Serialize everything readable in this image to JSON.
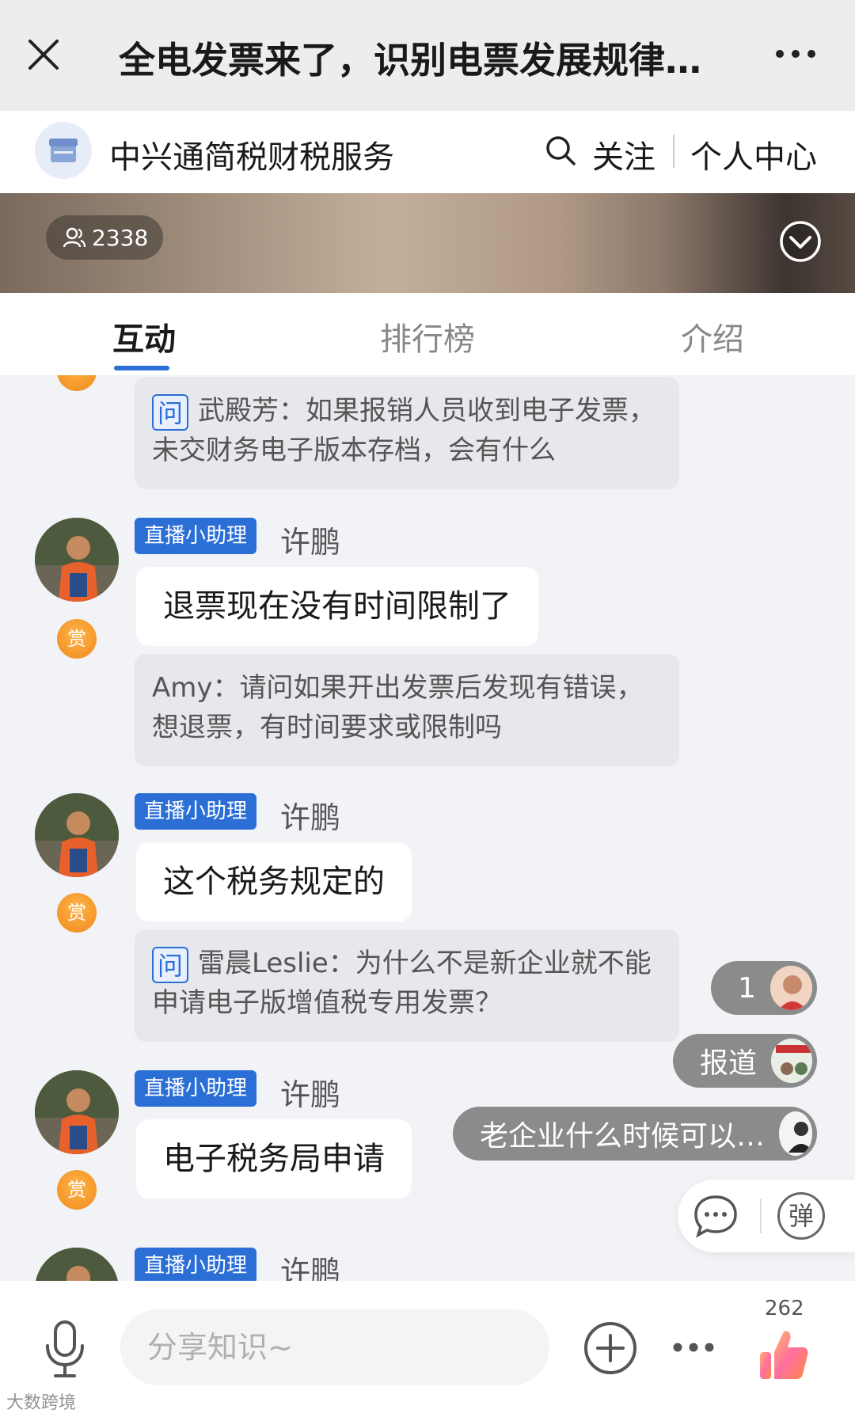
{
  "topbar": {
    "title": "全电发票来了，识别电票发展规律…"
  },
  "channel": {
    "name": "中兴通简税财税服务",
    "follow_label": "关注",
    "personal_label": "个人中心"
  },
  "video": {
    "viewer_count": "2338"
  },
  "tabs": [
    {
      "label": "互动",
      "active": true
    },
    {
      "label": "排行榜",
      "active": false
    },
    {
      "label": "介绍",
      "active": false
    }
  ],
  "feed": {
    "q_tag": "问",
    "role_tag": "直播小助理",
    "reward_label": "赏",
    "questions": [
      {
        "text": "武殿芳：如果报销人员收到电子发票，未交财务电子版本存档，会有什么"
      },
      {
        "text": "Amy：请问如果开出发票后发现有错误，想退票，有时间要求或限制吗"
      },
      {
        "text": "雷晨Leslie：为什么不是新企业就不能申请电子版增值税专用发票？"
      }
    ],
    "replies": [
      {
        "author": "许鹏",
        "text": "退票现在没有时间限制了"
      },
      {
        "author": "许鹏",
        "text": "这个税务规定的"
      },
      {
        "author": "许鹏",
        "text": "电子税务局申请"
      },
      {
        "author": "许鹏",
        "text": ""
      }
    ]
  },
  "danmu": [
    {
      "text": "1"
    },
    {
      "text": "报道"
    },
    {
      "text": "老企业什么时候可以…"
    }
  ],
  "toolbox": {
    "dan_label": "弹"
  },
  "bottombar": {
    "input_placeholder": "分享知识~",
    "like_count": "262"
  },
  "watermark": "大数跨境",
  "colors": {
    "accent": "#2b6fd6",
    "reward": "#f08a1e"
  }
}
